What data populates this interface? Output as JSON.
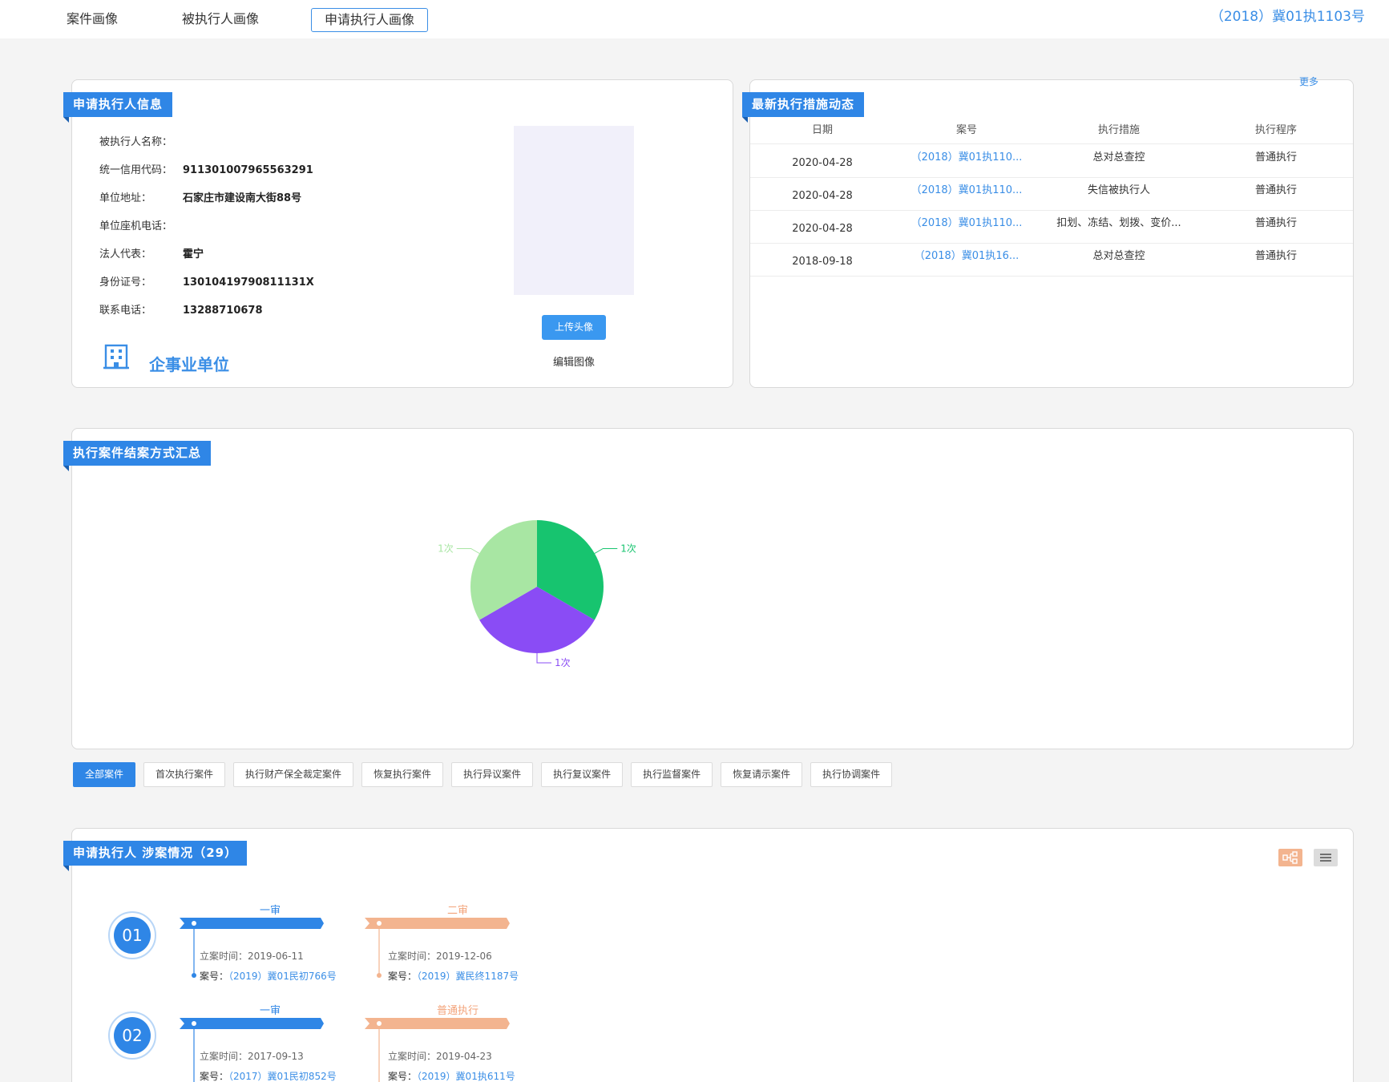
{
  "tabs": [
    "案件画像",
    "被执行人画像",
    "申请执行人画像"
  ],
  "active_tab_index": 2,
  "case_number": "（2018）冀01执1103号",
  "info_card": {
    "title": "申请执行人信息",
    "fields": [
      {
        "label": "被执行人名称：",
        "value": ""
      },
      {
        "label": "统一信用代码：",
        "value": "911301007965563291"
      },
      {
        "label": "单位地址：",
        "value": "石家庄市建设南大街88号"
      },
      {
        "label": "单位座机电话：",
        "value": ""
      },
      {
        "label": "法人代表：",
        "value": "霍宁"
      },
      {
        "label": "身份证号：",
        "value": "13010419790811131X"
      },
      {
        "label": "联系电话：",
        "value": "13288710678"
      }
    ],
    "upload_label": "上传头像",
    "edit_label": "编辑图像",
    "org_type": "企事业单位"
  },
  "measures": {
    "title": "最新执行措施动态",
    "more": "更多",
    "columns": [
      "日期",
      "案号",
      "执行措施",
      "执行程序"
    ],
    "rows": [
      {
        "date": "2020-04-28",
        "case": "（2018）冀01执110...",
        "measure": "总对总查控",
        "proc": "普通执行"
      },
      {
        "date": "2020-04-28",
        "case": "（2018）冀01执110...",
        "measure": "失信被执行人",
        "proc": "普通执行"
      },
      {
        "date": "2020-04-28",
        "case": "（2018）冀01执110...",
        "measure": "扣划、冻结、划拨、变价...",
        "proc": "普通执行"
      },
      {
        "date": "2018-09-18",
        "case": "（2018）冀01执16...",
        "measure": "总对总查控",
        "proc": "普通执行"
      }
    ]
  },
  "summary": {
    "title": "执行案件结案方式汇总"
  },
  "chart_data": {
    "type": "pie",
    "slices": [
      {
        "label": "1次",
        "value": 1,
        "color": "#17c46f"
      },
      {
        "label": "1次",
        "value": 1,
        "color": "#8a4cf5"
      },
      {
        "label": "1次",
        "value": 1,
        "color": "#a8e6a3"
      }
    ]
  },
  "filters": [
    "全部案件",
    "首次执行案件",
    "执行财产保全裁定案件",
    "恢复执行案件",
    "执行异议案件",
    "执行复议案件",
    "执行监督案件",
    "恢复请示案件",
    "执行协调案件"
  ],
  "involvement": {
    "title": "申请执行人 涉案情况（29）",
    "groups": [
      {
        "num": "01",
        "stages": [
          {
            "title": "一审",
            "time_label": "立案时间：",
            "time": "2019-06-11",
            "case_label": "案号：",
            "case": "（2019）冀01民初766号"
          },
          {
            "title": "二审",
            "time_label": "立案时间：",
            "time": "2019-12-06",
            "case_label": "案号：",
            "case": "（2019）冀民终1187号"
          }
        ]
      },
      {
        "num": "02",
        "stages": [
          {
            "title": "一审",
            "time_label": "立案时间：",
            "time": "2017-09-13",
            "case_label": "案号：",
            "case": "（2017）冀01民初852号"
          },
          {
            "title": "普通执行",
            "time_label": "立案时间：",
            "time": "2019-04-23",
            "case_label": "案号：",
            "case": "（2019）冀01执611号"
          }
        ]
      }
    ]
  },
  "colors": {
    "primary": "#2f86e6",
    "secondary": "#f3b48f"
  }
}
